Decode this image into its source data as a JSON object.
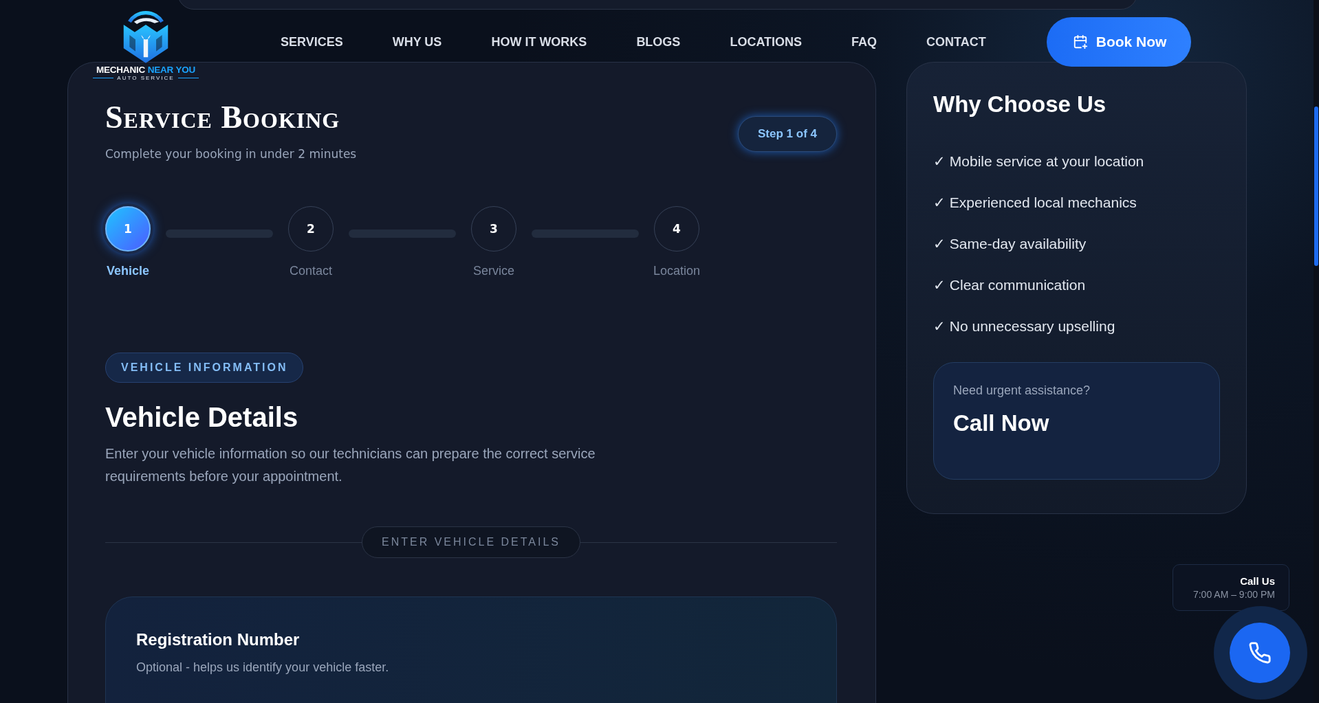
{
  "logo": {
    "name": "MECHANIC",
    "name_accent": "NEAR YOU",
    "tagline": "AUTO SERVICE"
  },
  "nav": {
    "items": [
      "SERVICES",
      "WHY US",
      "HOW IT WORKS",
      "BLOGS",
      "LOCATIONS",
      "FAQ",
      "CONTACT"
    ],
    "cta": "Book Now"
  },
  "booking": {
    "title": "Service Booking",
    "subtitle": "Complete your booking in under 2 minutes",
    "step_badge": "Step 1 of 4",
    "steps": [
      {
        "number": "1",
        "label": "Vehicle",
        "selected": true
      },
      {
        "number": "2",
        "label": "Contact",
        "selected": false
      },
      {
        "number": "3",
        "label": "Service",
        "selected": false
      },
      {
        "number": "4",
        "label": "Location",
        "selected": false
      }
    ],
    "section_tag": "VEHICLE INFORMATION",
    "heading": "Vehicle Details",
    "description": "Enter your vehicle information so our technicians can prepare the correct service requirements before your appointment.",
    "divider_label": "ENTER VEHICLE DETAILS",
    "field_card": {
      "title": "Registration Number",
      "hint": "Optional - helps us identify your vehicle faster."
    }
  },
  "sidebar": {
    "title": "Why Choose Us",
    "benefits": [
      "✓ Mobile service at your location",
      "✓ Experienced local mechanics",
      "✓ Same-day availability",
      "✓ Clear communication",
      "✓ No unnecessary upselling"
    ],
    "urgent": {
      "question": "Need urgent assistance?",
      "action": "Call Now"
    }
  },
  "call_widget": {
    "title": "Call Us",
    "hours": "7:00 AM – 9:00 PM"
  }
}
